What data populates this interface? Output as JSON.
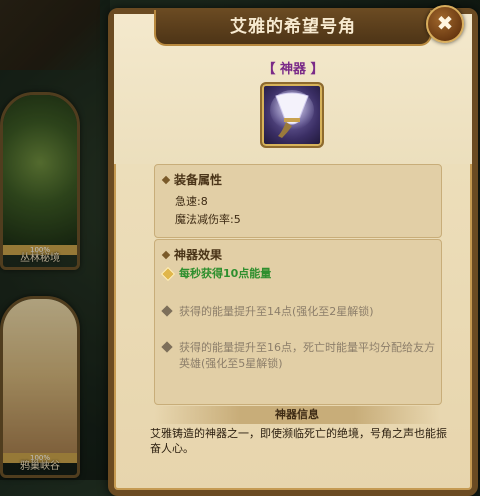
{
  "background": {
    "maps": [
      {
        "name": "丛林秘境",
        "percent": "100%"
      },
      {
        "name": "鸦巢峡谷",
        "percent": "100%"
      }
    ]
  },
  "item": {
    "title": "艾雅的希望号角",
    "type": "【 神器 】",
    "icon": "horn-icon"
  },
  "attributes": {
    "heading": "装备属性",
    "lines": [
      "急速:8",
      "魔法减伤率:5"
    ]
  },
  "effects": {
    "heading": "神器效果",
    "items": [
      {
        "text": "每秒获得10点能量",
        "active": true
      },
      {
        "text": "获得的能量提升至14点(强化至2星解锁)",
        "active": false
      },
      {
        "text": "获得的能量提升至16点，死亡时能量平均分配给友方英雄(强化至5星解锁)",
        "active": false
      }
    ]
  },
  "info": {
    "heading": "神器信息",
    "text": "艾雅铸造的神器之一，即使濒临死亡的绝境，号角之声也能振奋人心。"
  },
  "close_label": "✖",
  "colors": {
    "active_effect": "#2e8f2e",
    "locked_effect": "#8c7e6a",
    "type_label": "#7a2a88"
  }
}
